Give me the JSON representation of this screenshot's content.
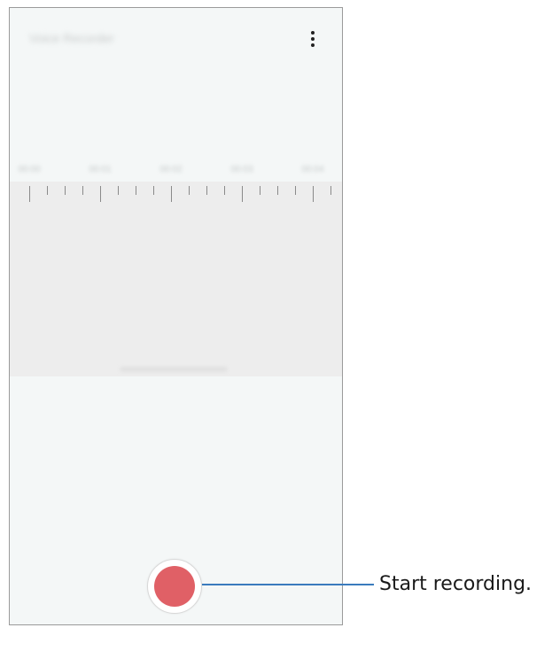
{
  "app": {
    "title": "Voice Recorder"
  },
  "header": {
    "more_icon": "more-vertical-icon"
  },
  "timeline": {
    "labels": [
      "00:00",
      "00:01",
      "00:02",
      "00:03",
      "00:04"
    ]
  },
  "controls": {
    "record_icon": "record-icon",
    "record_color": "#e06066"
  },
  "callout": {
    "text": "Start recording.",
    "line_color": "#3a7bbd"
  }
}
